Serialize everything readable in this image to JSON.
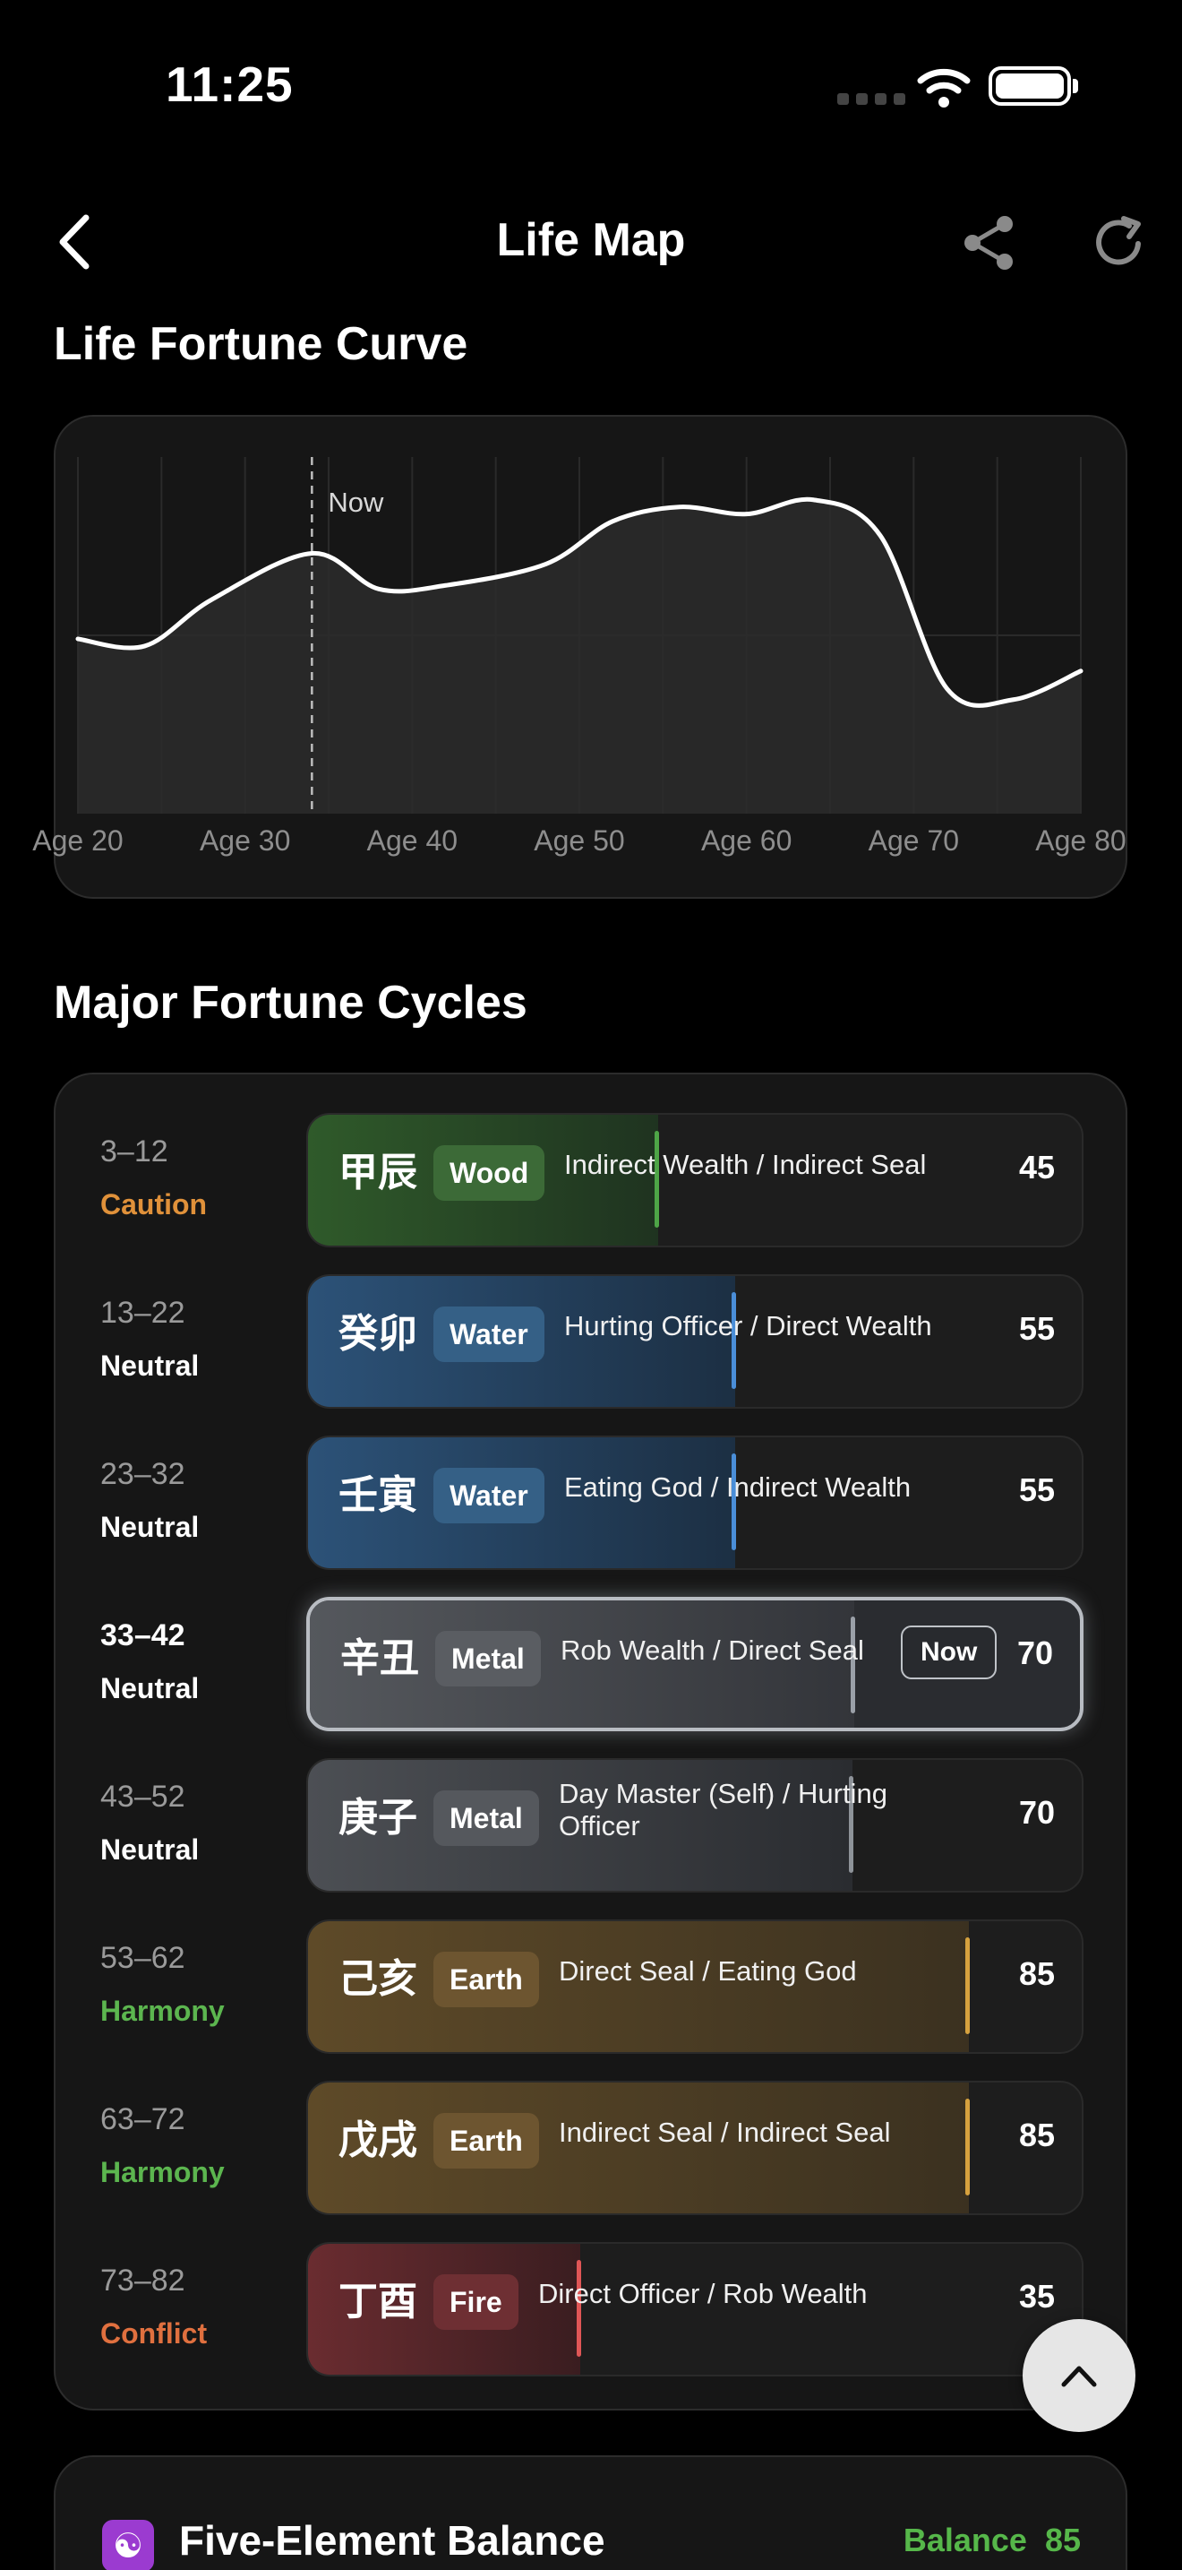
{
  "status": {
    "time": "11:25"
  },
  "nav": {
    "title": "Life Map"
  },
  "sections": {
    "curve_title": "Life Fortune Curve",
    "cycles_title": "Major Fortune Cycles"
  },
  "chart_data": {
    "type": "area",
    "x_ticks": [
      "Age 20",
      "Age 30",
      "Age 40",
      "Age 50",
      "Age 60",
      "Age 70",
      "Age 80"
    ],
    "xlim": [
      20,
      80
    ],
    "ylim": [
      0,
      100
    ],
    "marker": {
      "label": "Now",
      "x": 34
    },
    "series": [
      {
        "x": [
          20,
          24,
          28,
          34,
          38,
          42,
          48,
          52,
          56,
          60,
          64,
          68,
          72,
          76,
          80
        ],
        "y": [
          49,
          47,
          60,
          73,
          63,
          64,
          70,
          82,
          86,
          84,
          88,
          78,
          35,
          32,
          40
        ]
      }
    ],
    "colors": {
      "line": "#ffffff",
      "area": "#2c2c2c",
      "grid": "#2a2a2a"
    }
  },
  "cycles": [
    {
      "age": "3–12",
      "verdict": "Caution",
      "verdict_color": "#e0913a",
      "stem": "甲辰",
      "element": "Wood",
      "desc": "Indirect Wealth / Indirect Seal",
      "score": "45",
      "fill": 0.45,
      "color": "#4ea547",
      "tag_bg": "#3c6a37",
      "fill_from": "#2f5a2a",
      "fill_to": "#1f3320"
    },
    {
      "age": "13–22",
      "verdict": "Neutral",
      "verdict_color": "#ffffff",
      "stem": "癸卯",
      "element": "Water",
      "desc": "Hurting Officer / Direct Wealth",
      "score": "55",
      "fill": 0.55,
      "color": "#4a8ed8",
      "tag_bg": "#356086",
      "fill_from": "#2c5278",
      "fill_to": "#1c2f43"
    },
    {
      "age": "23–32",
      "verdict": "Neutral",
      "verdict_color": "#ffffff",
      "stem": "壬寅",
      "element": "Water",
      "desc": "Eating God / Indirect Wealth",
      "score": "55",
      "fill": 0.55,
      "color": "#4a8ed8",
      "tag_bg": "#356086",
      "fill_from": "#2c5278",
      "fill_to": "#1c2f43"
    },
    {
      "age": "33–42",
      "verdict": "Neutral",
      "verdict_color": "#ffffff",
      "stem": "辛丑",
      "element": "Metal",
      "desc": "Rob Wealth / Direct Seal",
      "score": "70",
      "fill": 0.7,
      "color": "#9aa0a8",
      "tag_bg": "#5a5d62",
      "fill_from": "#55585d",
      "fill_to": "#33353a",
      "current": true,
      "badge": "Now"
    },
    {
      "age": "43–52",
      "verdict": "Neutral",
      "verdict_color": "#ffffff",
      "stem": "庚子",
      "element": "Metal",
      "desc": "Day Master (Self) / Hurting Officer",
      "score": "70",
      "fill": 0.7,
      "color": "#8e9399",
      "tag_bg": "#55585d",
      "fill_from": "#4c4f54",
      "fill_to": "#2a2c30",
      "two_line": true
    },
    {
      "age": "53–62",
      "verdict": "Harmony",
      "verdict_color": "#5cb64f",
      "stem": "己亥",
      "element": "Earth",
      "desc": "Direct Seal / Eating God",
      "score": "85",
      "fill": 0.85,
      "color": "#d6a13e",
      "tag_bg": "#6d5530",
      "fill_from": "#5e4a28",
      "fill_to": "#3b3120"
    },
    {
      "age": "63–72",
      "verdict": "Harmony",
      "verdict_color": "#5cb64f",
      "stem": "戊戌",
      "element": "Earth",
      "desc": "Indirect Seal / Indirect Seal",
      "score": "85",
      "fill": 0.85,
      "color": "#d6a13e",
      "tag_bg": "#6d5530",
      "fill_from": "#5e4a28",
      "fill_to": "#3b3120"
    },
    {
      "age": "73–82",
      "verdict": "Conflict",
      "verdict_color": "#e0703f",
      "stem": "丁酉",
      "element": "Fire",
      "desc": "Direct Officer / Rob Wealth",
      "score": "35",
      "fill": 0.35,
      "color": "#e05656",
      "tag_bg": "#6e2f33",
      "fill_from": "#6a2c30",
      "fill_to": "#3a1d20"
    }
  ],
  "balance": {
    "title": "Five-Element Balance",
    "label": "Balance",
    "score": "85"
  },
  "icons": {
    "back": "chevron-left-icon",
    "share": "share-icon",
    "refresh": "refresh-icon",
    "scroll_top": "chevron-up-icon",
    "balance": "yin-yang-icon"
  }
}
